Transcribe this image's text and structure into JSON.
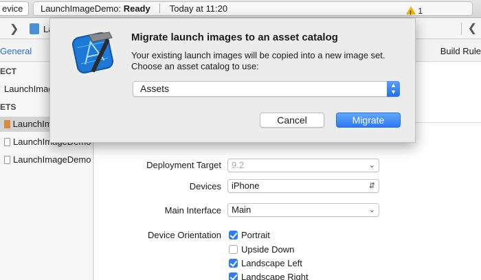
{
  "toolbar": {
    "device_label": "evice",
    "app_name": "LaunchImageDemo:",
    "status": "Ready",
    "time": "Today at 11:20",
    "warning_count": "1"
  },
  "jumpbar": {
    "crumb": "La"
  },
  "tabs": {
    "general": "General",
    "build_rules": "Build Rule"
  },
  "sidebar": {
    "project_header": "ECT",
    "project_item": "LaunchImag",
    "targets_header": "ETS",
    "target_selected": "LaunchIma",
    "items": [
      "LaunchImageDemoT...",
      "LaunchImageDemo..."
    ]
  },
  "settings": {
    "deployment_target": {
      "label": "Deployment Target",
      "value": "9.2"
    },
    "devices": {
      "label": "Devices",
      "value": "iPhone"
    },
    "main_interface": {
      "label": "Main Interface",
      "value": "Main"
    },
    "orientation": {
      "label": "Device Orientation",
      "options": [
        {
          "label": "Portrait",
          "checked": true
        },
        {
          "label": "Upside Down",
          "checked": false
        },
        {
          "label": "Landscape Left",
          "checked": true
        },
        {
          "label": "Landscape Right",
          "checked": true
        }
      ]
    }
  },
  "dialog": {
    "icon": "xcode-hammer-icon",
    "title": "Migrate launch images to an asset catalog",
    "message_line1": "Your existing launch images will be copied into a new image set.",
    "message_line2": "Choose an asset catalog to use:",
    "selected_catalog": "Assets",
    "cancel_label": "Cancel",
    "migrate_label": "Migrate"
  },
  "colors": {
    "accent": "#2b79f4",
    "warning": "#f0b400"
  }
}
